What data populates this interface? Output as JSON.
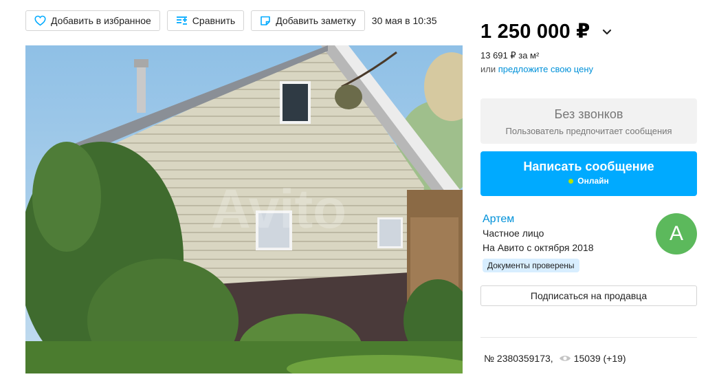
{
  "toolbar": {
    "favorite_label": "Добавить в избранное",
    "compare_label": "Сравнить",
    "note_label": "Добавить заметку",
    "date": "30 мая в 10:35"
  },
  "listing": {
    "price": "1 250 000 ₽",
    "price_per_m2": "13 691 ₽ за м²",
    "offer_prefix": "или",
    "offer_link": "предложите свою цену",
    "watermark": "Avito"
  },
  "contact": {
    "no_calls_title": "Без звонков",
    "no_calls_subtitle": "Пользователь предпочитает сообщения",
    "message_button": "Написать сообщение",
    "online_status": "Онлайн"
  },
  "seller": {
    "name": "Артем",
    "type": "Частное лицо",
    "since": "На Авито с октября 2018",
    "docs_badge": "Документы проверены",
    "avatar_letter": "А",
    "subscribe_label": "Подписаться на продавца"
  },
  "stats": {
    "listing_number": "№ 2380359173,",
    "views": "15039 (+19)"
  },
  "colors": {
    "accent": "#00aaff",
    "link": "#0091d9",
    "avatar": "#5cb95c",
    "online": "#b8e200"
  },
  "icons": [
    "heart-icon",
    "compare-icon",
    "note-icon",
    "chevron-down-icon",
    "eye-icon"
  ]
}
